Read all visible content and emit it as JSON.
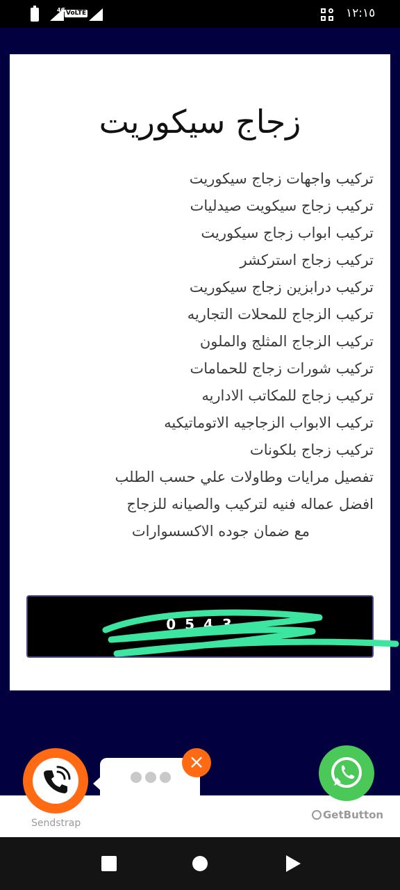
{
  "status_bar": {
    "time": "١٢:١٥",
    "network": "4G",
    "volte": "VoLTE"
  },
  "card": {
    "title": "زجاج سيكوريت",
    "services": [
      "تركيب واجهات زجاج سيكوريت",
      "تركيب زجاج سيكويت صيدليات",
      "تركيب ابواب زجاج سيكوريت",
      "تركيب زجاج استركشر",
      "تركيب درابزين زجاج سيكوريت",
      "تركيب الزجاج للمحلات التجاريه",
      "تركيب الزجاج المثلج والملون",
      "تركيب شورات زجاج للحمامات",
      "تركيب زجاج للمكاتب الاداريه",
      "تركيب الابواب الزجاجيه الاتوماتيكيه",
      "تركيب زجاج بلكونات",
      "تفصيل مرايات وطاولات علي حسب الطلب",
      "افضل عماله فنيه لتركيب والصيانه للزجاج",
      "مع ضمان جوده الاكسسوارات"
    ],
    "phone_partial": "0 5 4 3"
  },
  "widgets": {
    "sendstrap_label": "Sendstrap",
    "getbutton_label": "GetButton",
    "close_symbol": "×"
  },
  "colors": {
    "page_background": "#03003f",
    "accent_orange": "#ff6a13",
    "whatsapp_green": "#4ac959",
    "scribble_green": "#3de6a0"
  },
  "icons": {
    "call": "phone-call-icon",
    "whatsapp": "whatsapp-icon",
    "close": "close-icon",
    "typing": "typing-dots-icon"
  }
}
